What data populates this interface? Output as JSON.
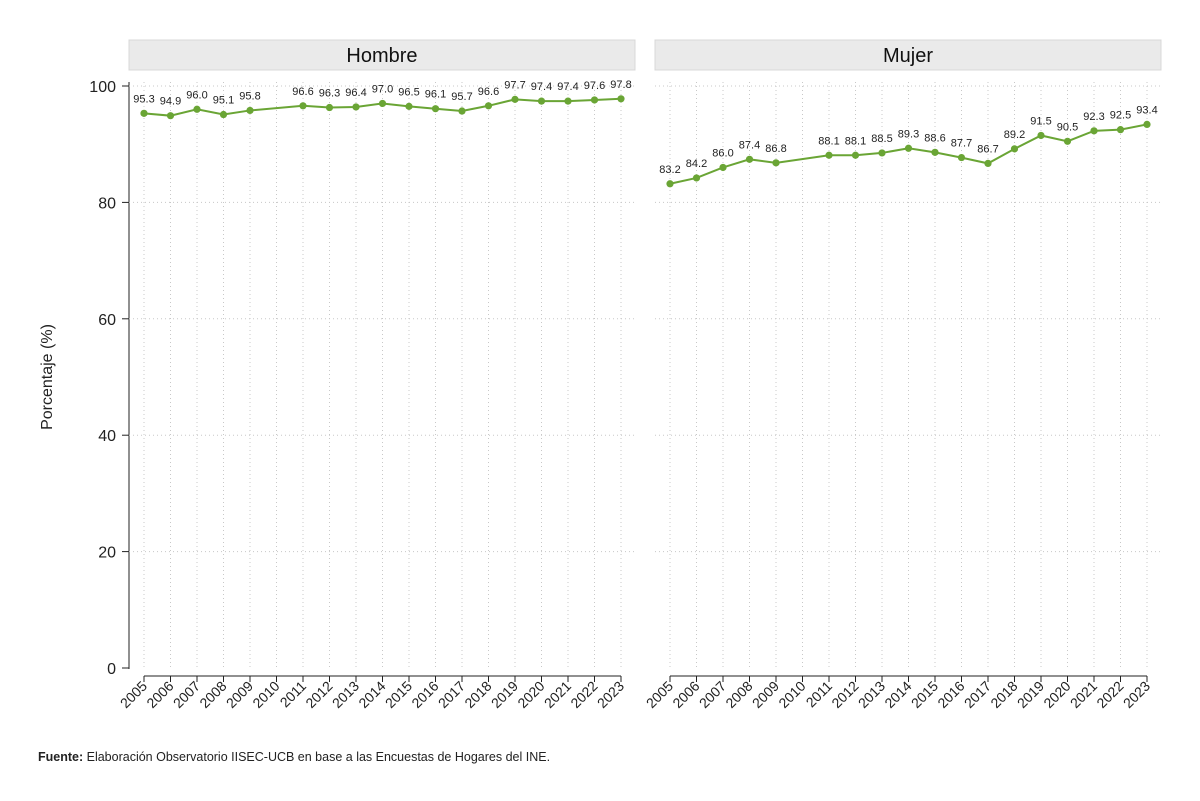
{
  "chart_data": {
    "type": "line",
    "ylabel": "Porcentaje (%)",
    "ylim": [
      0,
      100
    ],
    "y_ticks": [
      0,
      20,
      40,
      60,
      80,
      100
    ],
    "grid": true,
    "x": [
      "2005",
      "2006",
      "2007",
      "2008",
      "2009",
      "2010",
      "2011",
      "2012",
      "2013",
      "2014",
      "2015",
      "2016",
      "2017",
      "2018",
      "2019",
      "2020",
      "2021",
      "2022",
      "2023"
    ],
    "line_color": "#6aa535",
    "panel_header_color": "#eaeaea",
    "panels": [
      {
        "title": "Hombre",
        "x": [
          "2005",
          "2006",
          "2007",
          "2008",
          "2009",
          "2011",
          "2012",
          "2013",
          "2014",
          "2015",
          "2016",
          "2017",
          "2018",
          "2019",
          "2020",
          "2021",
          "2022",
          "2023"
        ],
        "values": [
          95.3,
          94.9,
          96.0,
          95.1,
          95.8,
          96.6,
          96.3,
          96.4,
          97.0,
          96.5,
          96.1,
          95.7,
          96.6,
          97.7,
          97.4,
          97.4,
          97.6,
          97.8
        ],
        "labels": [
          "95.3",
          "94.9",
          "96.0",
          "95.1",
          "95.8",
          "96.6",
          "96.3",
          "96.4",
          "97.0",
          "96.5",
          "96.1",
          "95.7",
          "96.6",
          "97.7",
          "97.4",
          "97.4",
          "97.6",
          "97.8"
        ]
      },
      {
        "title": "Mujer",
        "x": [
          "2005",
          "2006",
          "2007",
          "2008",
          "2009",
          "2011",
          "2012",
          "2013",
          "2014",
          "2015",
          "2016",
          "2017",
          "2018",
          "2019",
          "2020",
          "2021",
          "2022",
          "2023"
        ],
        "values": [
          83.2,
          84.2,
          86.0,
          87.4,
          86.8,
          88.1,
          88.1,
          88.5,
          89.3,
          88.6,
          87.7,
          86.7,
          89.2,
          91.5,
          90.5,
          92.3,
          92.5,
          93.4
        ],
        "labels": [
          "83.2",
          "84.2",
          "86.0",
          "87.4",
          "86.8",
          "88.1",
          "88.1",
          "88.5",
          "89.3",
          "88.6",
          "87.7",
          "86.7",
          "89.2",
          "91.5",
          "90.5",
          "92.3",
          "92.5",
          "93.4"
        ]
      }
    ]
  },
  "source": {
    "label": "Fuente:",
    "text": " Elaboración Observatorio IISEC-UCB en base a las Encuestas de Hogares del INE."
  }
}
